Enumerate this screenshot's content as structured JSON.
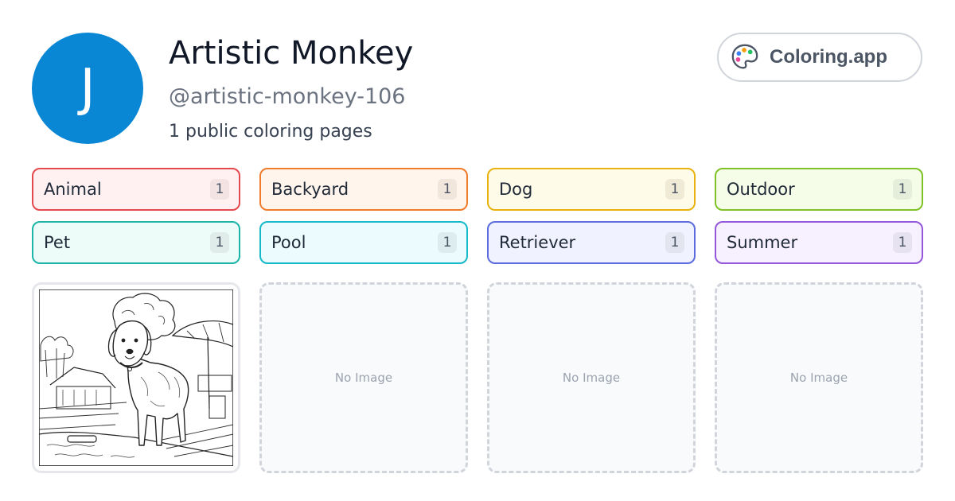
{
  "profile": {
    "avatar_initial": "J",
    "avatar_color": "#0a87d4",
    "name": "Artistic Monkey",
    "handle": "@artistic-monkey-106",
    "count_text": "1 public coloring pages"
  },
  "brand": {
    "icon": "palette-icon",
    "label": "Coloring.app"
  },
  "tags": [
    {
      "label": "Animal",
      "count": "1",
      "border": "#e5484d",
      "bg": "#fff1f1",
      "badge": "#f3e3e3"
    },
    {
      "label": "Backyard",
      "count": "1",
      "border": "#f07b2b",
      "bg": "#fff5ec",
      "badge": "#f1e6dc"
    },
    {
      "label": "Dog",
      "count": "1",
      "border": "#e9b20e",
      "bg": "#fffbe9",
      "badge": "#efead6"
    },
    {
      "label": "Outdoor",
      "count": "1",
      "border": "#7ec228",
      "bg": "#f5fde9",
      "badge": "#e5eedb"
    },
    {
      "label": "Pet",
      "count": "1",
      "border": "#1cb5a7",
      "bg": "#eefcf9",
      "badge": "#dfecea"
    },
    {
      "label": "Pool",
      "count": "1",
      "border": "#16b9c9",
      "bg": "#ecfcfe",
      "badge": "#dcecef"
    },
    {
      "label": "Retriever",
      "count": "1",
      "border": "#5c6bde",
      "bg": "#f0f2ff",
      "badge": "#e2e4f0"
    },
    {
      "label": "Summer",
      "count": "1",
      "border": "#9456db",
      "bg": "#f6f0ff",
      "badge": "#e7e2f0"
    }
  ],
  "cards": [
    {
      "type": "image",
      "subject": "dog-coloring-page"
    },
    {
      "type": "empty",
      "label": "No Image"
    },
    {
      "type": "empty",
      "label": "No Image"
    },
    {
      "type": "empty",
      "label": "No Image"
    }
  ]
}
